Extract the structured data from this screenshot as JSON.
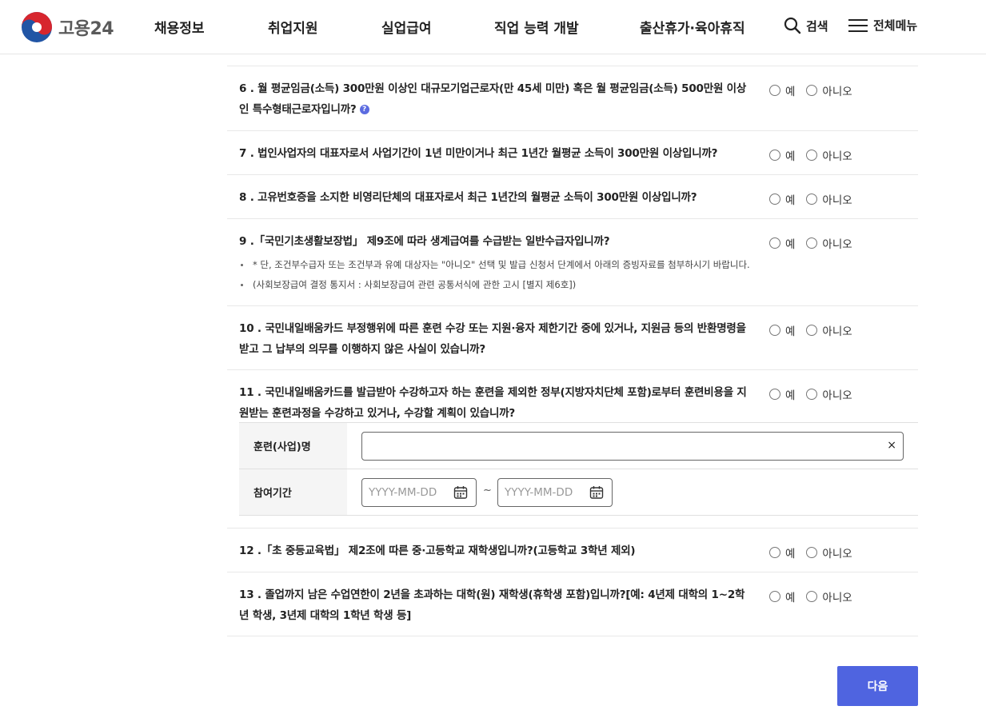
{
  "header": {
    "logo_text": "고용24",
    "nav": [
      "채용정보",
      "취업지원",
      "실업급여",
      "직업 능력 개발",
      "출산휴가·육아휴직"
    ],
    "search_label": "검색",
    "menu_label": "전체메뉴"
  },
  "options": {
    "yes": "예",
    "no": "아니오"
  },
  "questions": [
    {
      "text": "6 . 월 평균임금(소득) 300만원 이상인 대규모기업근로자(만 45세 미만) 혹은 월 평균임금(소득) 500만원 이상인 특수형태근로자입니까?",
      "help": "?"
    },
    {
      "text": "7 . 법인사업자의 대표자로서 사업기간이 1년 미만이거나 최근 1년간 월평균 소득이 300만원 이상입니까?"
    },
    {
      "text": "8 . 고유번호증을 소지한 비영리단체의 대표자로서 최근 1년간의 월평균 소득이 300만원 이상입니까?"
    },
    {
      "text": "9 .「국민기초생활보장법」 제9조에 따라 생계급여를 수급받는 일반수급자입니까?",
      "notes": [
        "* 단, 조건부수급자 또는 조건부과 유예 대상자는 \"아니오\" 선택 및 발급 신청서 단계에서 아래의 증빙자료를 첨부하시기 바랍니다.",
        "(사회보장급여 결정 통지서 : 사회보장급여 관련 공통서식에 관한 고시 [별지 제6호])"
      ]
    },
    {
      "text": "10 . 국민내일배움카드 부정행위에 따른 훈련 수강 또는 지원·융자 제한기간 중에 있거나, 지원금 등의 반환명령을 받고 그 납부의 의무를 이행하지 않은 사실이 있습니까?"
    },
    {
      "text": "11 . 국민내일배움카드를 발급받아 수강하고자 하는 훈련을 제외한 정부(지방자치단체 포함)로부터 훈련비용을 지원받는 훈련과정을 수강하고 있거나, 수강할 계획이 있습니까?"
    },
    {
      "text": "12 .「초 중등교육법」 제2조에 따른 중·고등학교 재학생입니까?(고등학교 3학년 제외)"
    },
    {
      "text": "13 . 졸업까지 남은 수업연한이 2년을 초과하는 대학(원) 재학생(휴학생 포함)입니까?[예: 4년제 대학의 1~2학년 학생, 3년제 대학의 1학년 학생 등]"
    }
  ],
  "subform": {
    "name_label": "훈련(사업)명",
    "name_value": "",
    "clear_icon": "×",
    "period_label": "참여기간",
    "date_placeholder": "YYYY-MM-DD",
    "tilde": "~"
  },
  "next_label": "다음",
  "colors": {
    "primary": "#4f64e0"
  }
}
